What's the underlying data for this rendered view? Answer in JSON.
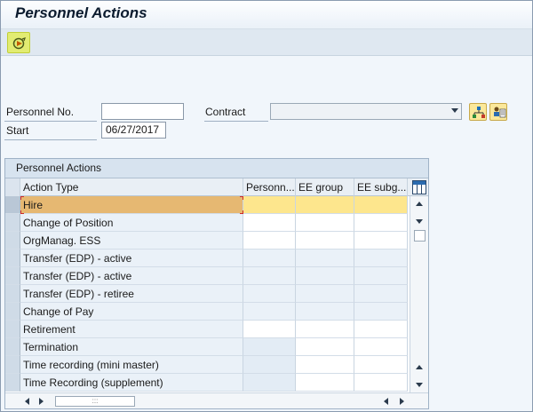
{
  "window": {
    "title": "Personnel Actions"
  },
  "toolbar": {
    "execute_icon": "execute-icon",
    "execute_color": "#e2ec72"
  },
  "form": {
    "personnel_no_label": "Personnel No.",
    "personnel_no_value": "",
    "contract_label": "Contract",
    "contract_value": "",
    "start_label": "Start",
    "start_value": "06/27/2017"
  },
  "table": {
    "title": "Personnel Actions",
    "headers": [
      "Action Type",
      "Personn...",
      "EE group",
      "EE subg..."
    ],
    "rows": [
      "Hire",
      "Change of Position",
      "OrgManag. ESS",
      "Transfer (EDP) - active",
      "Transfer (EDP) - active",
      "Transfer (EDP) - retiree",
      "Change of Pay",
      "Retirement",
      "Termination",
      "Time recording (mini master)",
      "Time Recording (supplement)"
    ],
    "selected_row": 0,
    "highlight_color": "#fde68d"
  }
}
